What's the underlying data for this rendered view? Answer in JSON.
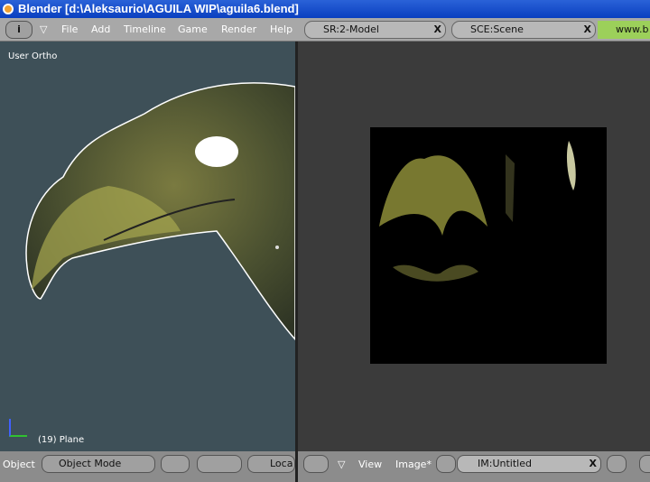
{
  "window": {
    "title": "Blender [d:\\Aleksaurio\\AGUILA  WIP\\aguila6.blend]"
  },
  "menu": {
    "items": [
      "File",
      "Add",
      "Timeline",
      "Game",
      "Render",
      "Help"
    ],
    "screen": "SR:2-Model",
    "scene": "SCE:Scene",
    "link": "www.b"
  },
  "viewport3d": {
    "view_label": "User Ortho",
    "object_label": "(19) Plane"
  },
  "header3d": {
    "menu": "Object",
    "mode": "Object Mode",
    "local": "Loca"
  },
  "image_editor": {
    "view": "View",
    "image": "Image*",
    "image_name": "IM:Untitled"
  },
  "colors": {
    "accent": "#2a62d8",
    "viewport_bg": "#3e5058",
    "texture": "#b8b860"
  }
}
